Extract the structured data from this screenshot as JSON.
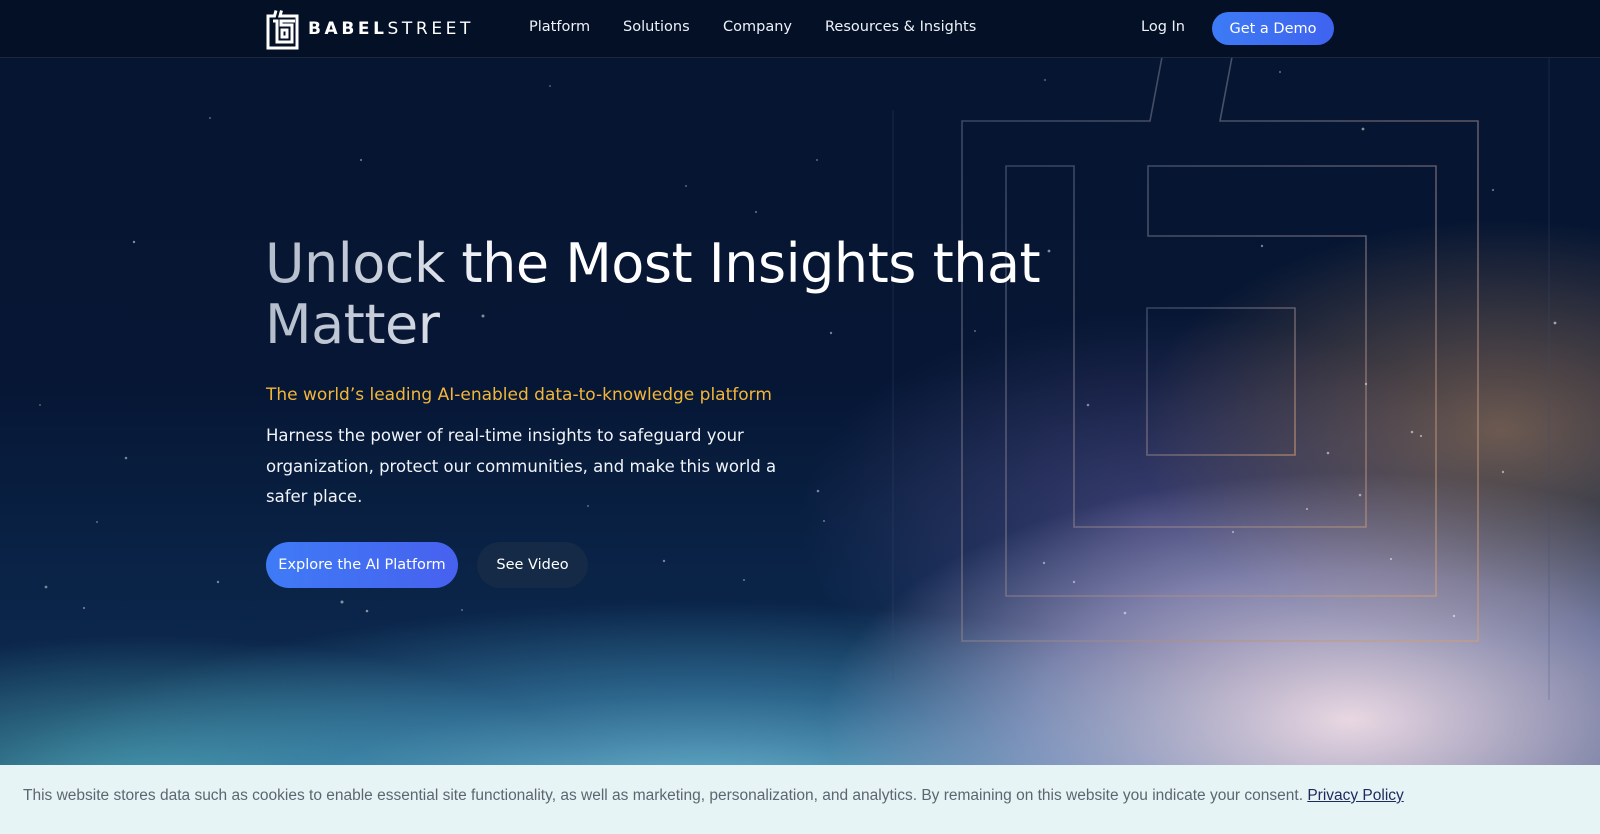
{
  "header": {
    "logo": {
      "word_bold": "BABEL",
      "word_light": "STREET"
    },
    "nav": [
      {
        "label": "Platform"
      },
      {
        "label": "Solutions"
      },
      {
        "label": "Company"
      },
      {
        "label": "Resources & Insights"
      }
    ],
    "login_label": "Log In",
    "demo_label": "Get a Demo"
  },
  "hero": {
    "headline": "Unlock the Most Insights that Matter",
    "tagline": "The world’s leading AI-enabled data-to-knowledge platform",
    "description": "Harness the power of real-time insights to safeguard your organization, protect our communities, and make this world a safer place.",
    "primary_cta": "Explore the AI Platform",
    "secondary_cta": "See Video"
  },
  "cookie_banner": {
    "text": "This website stores data such as cookies to enable essential site functionality, as well as marketing, personalization, and analytics. By remaining on this website you indicate your consent.",
    "link_label": "Privacy Policy"
  },
  "colors": {
    "accent_blue": "#3f6ef2",
    "tagline_gold": "#f3b63a",
    "background_navy": "#04132b",
    "cookie_bg": "#e6f4f6"
  }
}
